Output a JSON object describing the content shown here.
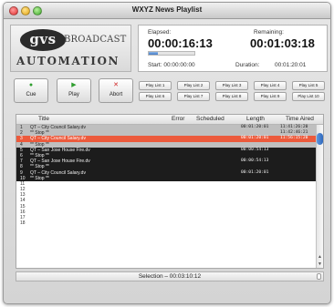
{
  "window": {
    "title": "WXYZ News Playlist"
  },
  "logo": {
    "mark": "gvs",
    "broadcast": "BROADCAST",
    "automation": "AUTOMATION"
  },
  "timer": {
    "elapsed_label": "Elapsed:",
    "elapsed_value": "00:00:16:13",
    "remaining_label": "Remaining:",
    "remaining_value": "00:01:03:18",
    "start_label": "Start: 00:00:00:00",
    "duration_label": "Duration:",
    "duration_value": "00:01:20:01",
    "progress_percent": 20,
    "progress_color": "#3e79c6"
  },
  "transport": [
    {
      "label": "Cue",
      "icon": "cue-dot-icon",
      "icon_glyph": "●",
      "color": "#2f9e2f"
    },
    {
      "label": "Play",
      "icon": "play-icon",
      "icon_glyph": "▶",
      "color": "#2f9e2f"
    },
    {
      "label": "Abort",
      "icon": "abort-x-icon",
      "icon_glyph": "✕",
      "color": "#d02424"
    }
  ],
  "playlists": [
    "Play List 1",
    "Play List 2",
    "Play List 3",
    "Play List 4",
    "Play List 5",
    "Play List 6",
    "Play List 7",
    "Play List 8",
    "Play List 9",
    "Play List 10"
  ],
  "table": {
    "headers": {
      "title": "Title",
      "error": "Error",
      "scheduled": "Scheduled",
      "length": "Length",
      "time_aired": "Time Aired"
    },
    "rows": [
      {
        "num": "1",
        "title": "QT – City Council Salary.dv",
        "length": "00:01:20:01",
        "aired": "11:41:26:20",
        "state": "played"
      },
      {
        "num": "2",
        "title": "** Stop **",
        "length": "",
        "aired": "11:42:46:21",
        "state": "played"
      },
      {
        "num": "3",
        "title": "QT – City Council Salary.dv",
        "length": "00:01:20:01",
        "aired": "11:56:15:20",
        "state": "live"
      },
      {
        "num": "4",
        "title": "** Stop **",
        "length": "",
        "aired": "",
        "state": "played"
      },
      {
        "num": "5",
        "title": "QT – San Jose House Fire.dv",
        "length": "00:00:54:13",
        "aired": "",
        "state": "dark"
      },
      {
        "num": "6",
        "title": "** Stop **",
        "length": "",
        "aired": "",
        "state": "dark"
      },
      {
        "num": "7",
        "title": "QT – San Jose House Fire.dv",
        "length": "00:00:54:13",
        "aired": "",
        "state": "dark"
      },
      {
        "num": "8",
        "title": "** Stop **",
        "length": "",
        "aired": "",
        "state": "dark"
      },
      {
        "num": "9",
        "title": "QT – City Council Salary.dv",
        "length": "00:01:20:01",
        "aired": "",
        "state": "dark"
      },
      {
        "num": "10",
        "title": "** Stop **",
        "length": "",
        "aired": "",
        "state": "dark"
      },
      {
        "num": "11",
        "title": "",
        "length": "",
        "aired": "",
        "state": "empty"
      },
      {
        "num": "12",
        "title": "",
        "length": "",
        "aired": "",
        "state": "empty"
      },
      {
        "num": "13",
        "title": "",
        "length": "",
        "aired": "",
        "state": "empty"
      },
      {
        "num": "14",
        "title": "",
        "length": "",
        "aired": "",
        "state": "empty"
      },
      {
        "num": "15",
        "title": "",
        "length": "",
        "aired": "",
        "state": "empty"
      },
      {
        "num": "16",
        "title": "",
        "length": "",
        "aired": "",
        "state": "empty"
      },
      {
        "num": "17",
        "title": "",
        "length": "",
        "aired": "",
        "state": "empty"
      },
      {
        "num": "18",
        "title": "",
        "length": "",
        "aired": "",
        "state": "empty"
      }
    ]
  },
  "status": {
    "selection": "Selection – 00:03:10:12"
  }
}
